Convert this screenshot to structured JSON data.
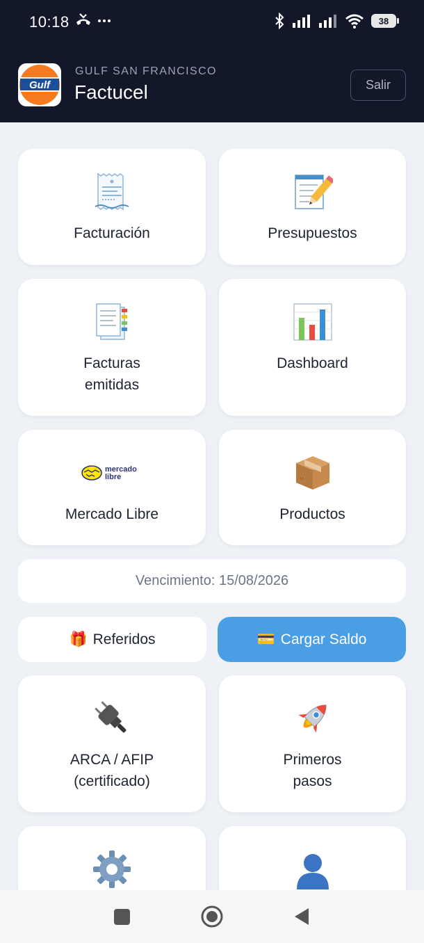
{
  "status_bar": {
    "time": "10:18",
    "left_icons": [
      "missed-call-icon",
      "more-dots-icon"
    ],
    "right_icons": [
      "bluetooth-icon",
      "signal-icon",
      "signal-icon",
      "wifi-icon"
    ],
    "battery": "38"
  },
  "header": {
    "logo_text": "Gulf",
    "subtitle": "GULF SAN FRANCISCO",
    "title": "Factucel",
    "logout_label": "Salir"
  },
  "tiles": [
    {
      "label": "Facturación",
      "icon": "receipt-icon"
    },
    {
      "label": "Presupuestos",
      "icon": "memo-icon"
    },
    {
      "label": "Facturas\nemitidas",
      "icon": "documents-icon"
    },
    {
      "label": "Dashboard",
      "icon": "bar-chart-icon"
    },
    {
      "label": "Mercado Libre",
      "icon": "mercado-libre-logo",
      "logo_text_1": "mercado",
      "logo_text_2": "libre"
    },
    {
      "label": "Productos",
      "icon": "package-icon"
    },
    {
      "label": "ARCA / AFIP\n(certificado)",
      "icon": "plug-icon"
    },
    {
      "label": "Primeros\npasos",
      "icon": "rocket-icon"
    },
    {
      "label": "",
      "icon": "gear-icon"
    },
    {
      "label": "",
      "icon": "user-icon"
    }
  ],
  "expiry": "Vencimiento: 15/08/2026",
  "actions": {
    "referrals": {
      "emoji": "🎁",
      "label": "Referidos"
    },
    "topup": {
      "emoji": "💳",
      "label": "Cargar Saldo"
    }
  },
  "colors": {
    "header_bg": "#121729",
    "page_bg": "#eef2f7",
    "accent": "#4a9fe4"
  },
  "nav": [
    "recents-square-icon",
    "home-circle-icon",
    "back-triangle-icon"
  ]
}
